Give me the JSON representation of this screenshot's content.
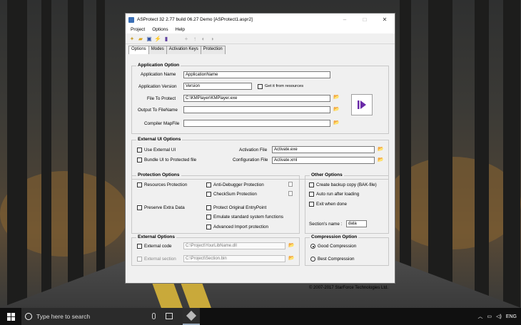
{
  "window": {
    "title": "ASProtect 32 2.77 build 06.27 Demo [ASProtect1.aspr2]",
    "controls": {
      "minimize": "–",
      "maximize": "□",
      "close": "✕"
    }
  },
  "menu": [
    "Project",
    "Options",
    "Help"
  ],
  "tabs": [
    "Options",
    "Modes",
    "Activation Keys",
    "Protection"
  ],
  "application_option": {
    "title": "Application Option",
    "name_label": "Application Name",
    "name_value": "ApplicationName",
    "version_label": "Application Version",
    "version_value": "Version",
    "get_from_resources": "Get it from resources",
    "file_label": "File To Protect",
    "file_value": "C:\\KMPlayer\\KMPlayer.exe",
    "output_label": "Output To FileName",
    "output_value": "",
    "mapfile_label": "Compiler MapFile",
    "mapfile_value": ""
  },
  "external_ui": {
    "title": "External UI Options",
    "use_external": "Use External UI",
    "bundle": "Bundle UI to Protected file",
    "activation_label": "Activation File",
    "activation_value": "Activate.exe",
    "config_label": "Configuration File",
    "config_value": "Activate.xml"
  },
  "protection_options": {
    "title": "Protection Options",
    "resources": "Resources Protection",
    "preserve": "Preserve Extra Data",
    "anti_debugger": "Anti-Debugger Protection",
    "checksum": "CheckSum Protection",
    "entrypoint": "Protect Original EntryPoint",
    "emulate": "Emulate standard system functions",
    "import": "Advanced Import protection"
  },
  "other_options": {
    "title": "Other Options",
    "backup": "Create backup copy (BAK-file)",
    "autorun": "Auto run after loading",
    "exit": "Exit when done",
    "section_label": "Section's name :",
    "section_value": "data"
  },
  "external_options": {
    "title": "External Options",
    "code_label": "External code",
    "code_value": "C:\\Project\\YourLibName.dll",
    "section_label": "External section",
    "section_value": "C:\\Project\\Section.bin"
  },
  "compression": {
    "title": "Compression Option",
    "good": "Good Compression",
    "best": "Best Compression"
  },
  "copyright": "© 2007-2017   StarForce Technologies Ltd.",
  "taskbar": {
    "search_placeholder": "Type here to search",
    "language": "ENG"
  }
}
